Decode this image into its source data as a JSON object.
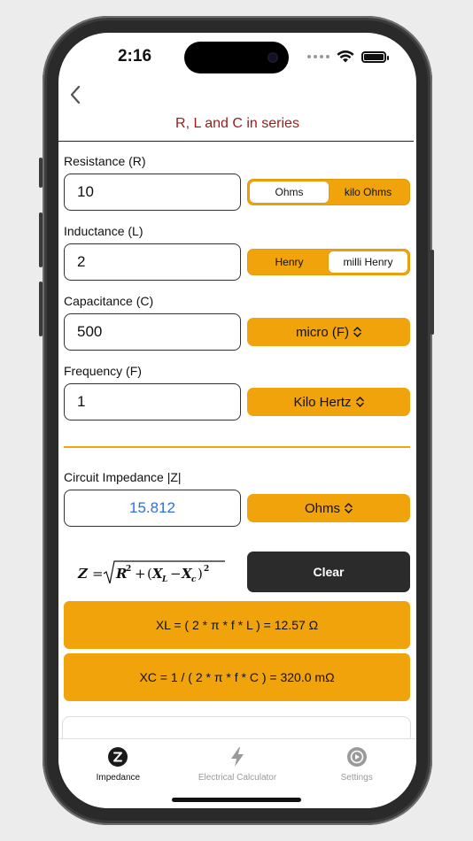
{
  "status_bar": {
    "time": "2:16"
  },
  "header": {
    "title": "R, L and C in series"
  },
  "resistance": {
    "label": "Resistance (R)",
    "value": "10",
    "units": [
      "Ohms",
      "kilo Ohms"
    ],
    "selected_unit": "Ohms"
  },
  "inductance": {
    "label": "Inductance (L)",
    "value": "2",
    "units": [
      "Henry",
      "milli Henry"
    ],
    "selected_unit": "milli Henry"
  },
  "capacitance": {
    "label": "Capacitance (C)",
    "value": "500",
    "unit": "micro (F)"
  },
  "frequency": {
    "label": "Frequency (F)",
    "value": "1",
    "unit": "Kilo Hertz"
  },
  "impedance": {
    "label": "Circuit Impedance |Z|",
    "value": "15.812",
    "unit": "Ohms"
  },
  "formula": {
    "lhs": "Z",
    "eq": "=",
    "r": "R",
    "sq": "2",
    "plus": "+",
    "lp": "(",
    "xl": "X",
    "xl_sub": "L",
    "minus": "−",
    "xc": "X",
    "xc_sub": "c",
    "rp": ")"
  },
  "clear_label": "Clear",
  "results": {
    "xl": "XL = ( 2 * π * f * L ) = 12.57 Ω",
    "xc": "XC = 1 / ( 2 * π * f * C ) = 320.0 mΩ"
  },
  "tabs": [
    {
      "label": "Impedance",
      "icon": "z-circle-icon"
    },
    {
      "label": "Electrical Calculator",
      "icon": "bolt-icon"
    },
    {
      "label": "Settings",
      "icon": "settings-icon"
    }
  ],
  "colors": {
    "accent": "#f0a30a",
    "title": "#9a1c1c",
    "result": "#2f6fd6",
    "clear_button": "#2b2b2b"
  }
}
